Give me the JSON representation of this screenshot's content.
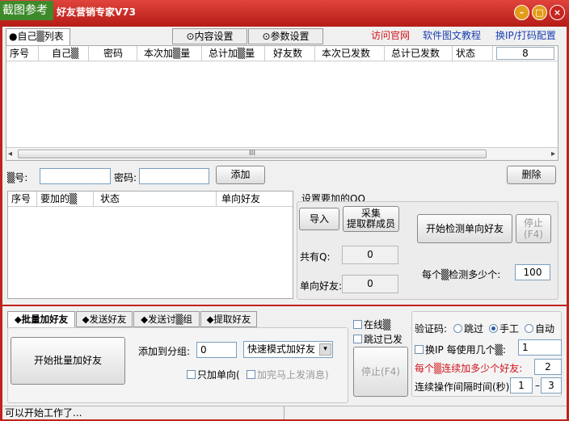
{
  "window": {
    "sticker": "截图参考",
    "title": "好友营销专家V73",
    "min_icon": "minimize-icon",
    "max_icon": "maximize-icon",
    "close_icon": "close-icon"
  },
  "top_tabs": [
    {
      "label": "●自己▒列表"
    },
    {
      "label": "⊙内容设置"
    },
    {
      "label": "⊙参数设置"
    }
  ],
  "links": {
    "official": "访问官网",
    "tutorial": "软件图文教程",
    "config": "换IP/打码配置"
  },
  "account_table": {
    "headers": [
      "序号",
      "自己▒",
      "密码",
      "本次加▒量",
      "总计加▒量",
      "好友数",
      "本次已发数",
      "总计已发数",
      "状态"
    ],
    "count": "8",
    "scroll_mark": "III"
  },
  "account_form": {
    "account_label": "▒号:",
    "password_label": "密码:",
    "add_button": "添加",
    "delete_button": "删除"
  },
  "target_table": {
    "headers": [
      "序号",
      "要加的▒",
      "状态",
      "单向好友"
    ]
  },
  "set_panel": {
    "title": "设置要加的QQ",
    "import_button": "导入",
    "collect_button_line1": "采集",
    "collect_button_line2": "提取群成员",
    "total_label": "共有Q:",
    "total_value": "0",
    "oneway_label": "单向好友:",
    "oneway_value": "0",
    "check_oneway_button": "开始检测单向好友",
    "stop_button_line1": "停止",
    "stop_button_line2": "(F4)",
    "per_check_label": "每个▒检测多少个:",
    "per_check_value": "100"
  },
  "bottom_tabs": [
    {
      "label": "◆批量加好友"
    },
    {
      "label": "◆发送好友"
    },
    {
      "label": "◆发送讨▒组"
    },
    {
      "label": "◆提取好友"
    }
  ],
  "batch": {
    "start_button": "开始批量加好友",
    "group_label": "添加到分组:",
    "group_value": "0",
    "mode_value": "快速模式加好友",
    "oneway_only": "只加单向(",
    "send_after": "加完马上发消息)"
  },
  "options": {
    "online": "在线▒",
    "skip_sent": "跳过已发",
    "stop_button": "停止(F4)"
  },
  "captcha": {
    "label": "验证码:",
    "skip": "跳过",
    "manual": "手工",
    "auto": "自动",
    "change_ip_label": "换IP  每使用几个▒:",
    "change_ip_value": "1",
    "per_add_label": "每个▒连续加多少个好友:",
    "per_add_value": "2",
    "interval_label": "连续操作间隔时间(秒)",
    "interval_from": "1",
    "interval_to": "3",
    "dash": "–"
  },
  "status": {
    "text": "可以开始工作了..."
  },
  "colors": {
    "frame": "#c0221c",
    "link_red": "#d0141c",
    "link_blue": "#1a3fb0",
    "warn_red": "#d0141c"
  }
}
